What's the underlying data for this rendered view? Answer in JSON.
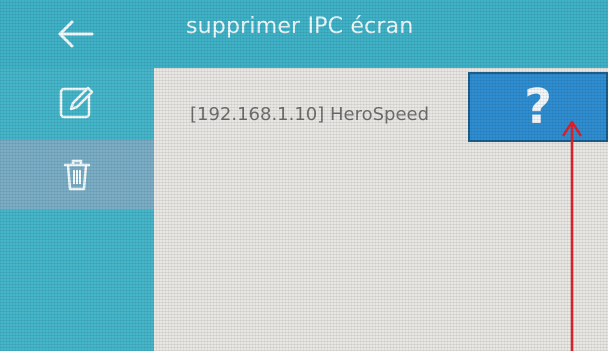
{
  "header": {
    "title": "supprimer IPC écran",
    "back_icon": "arrow-left-icon"
  },
  "sidebar": {
    "items": [
      {
        "icon": "edit-icon",
        "selected": false
      },
      {
        "icon": "trash-icon",
        "selected": true
      }
    ]
  },
  "content": {
    "ipc_list": [
      {
        "label": "[192.168.1.10] HeroSpeed"
      }
    ],
    "help_button": {
      "label": "?"
    }
  },
  "annotation": {
    "icon": "red-arrow-up",
    "color": "#e0202a"
  },
  "colors": {
    "header_bg": "#3fb2c7",
    "sidebar_bg": "#45b6ca",
    "selected_bg": "#7aaec6",
    "content_bg": "#e9e7e4",
    "help_button_bg": "#2f8ed1"
  }
}
